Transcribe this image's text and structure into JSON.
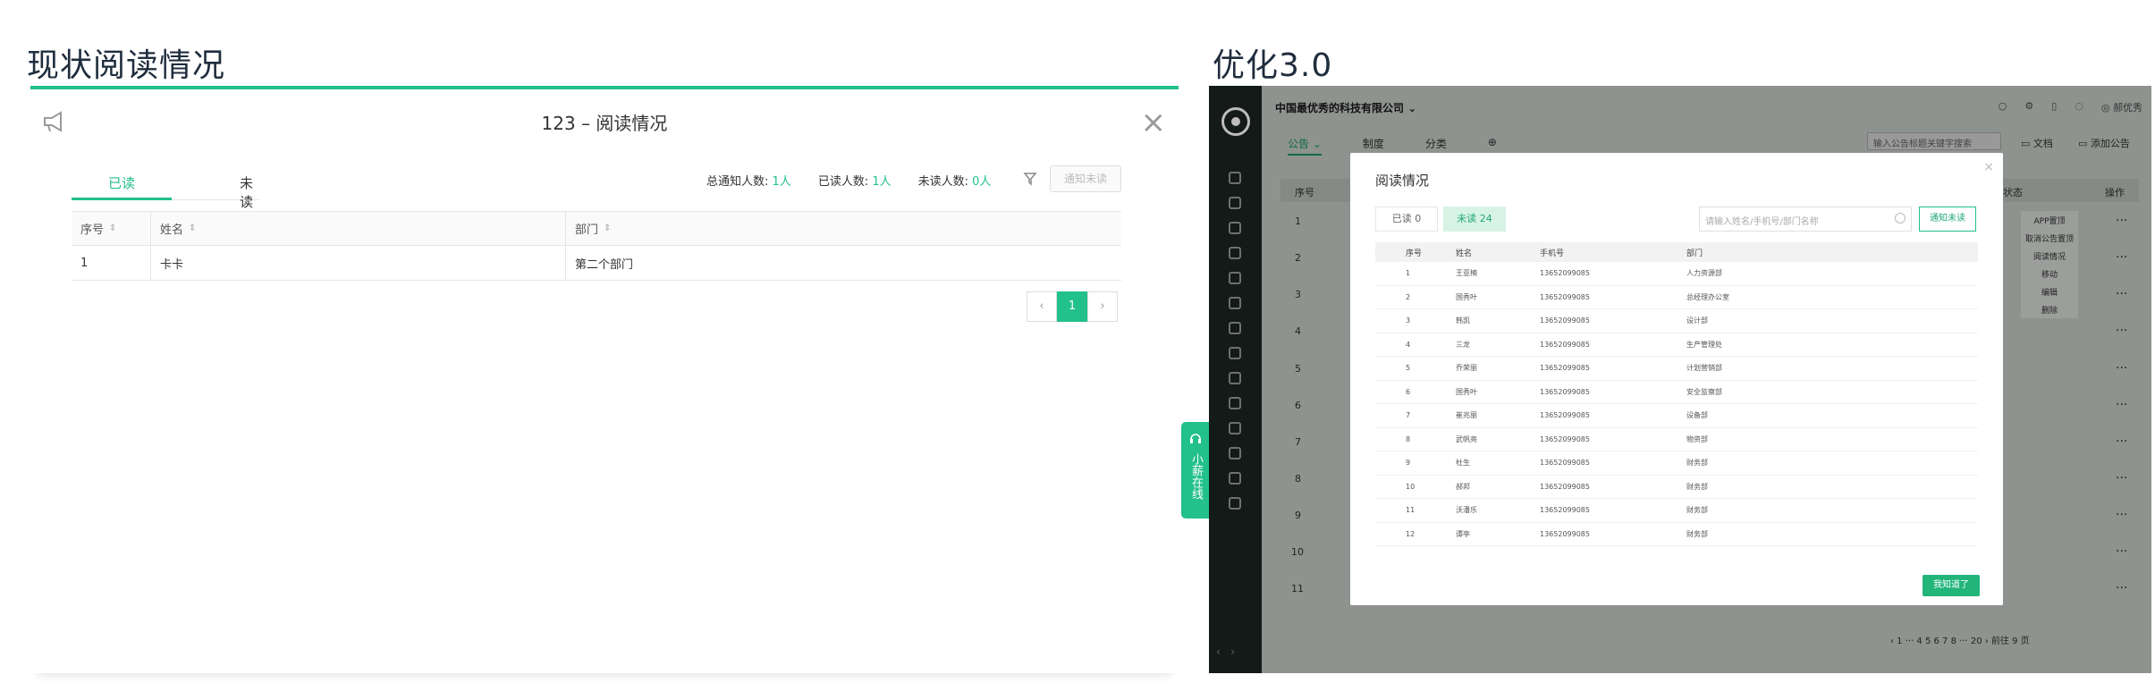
{
  "left_heading": "现状阅读情况",
  "right_heading": "优化3.0",
  "left_panel": {
    "title": "123 – 阅读情况",
    "tabs": [
      "已读",
      "未读"
    ],
    "stats": [
      {
        "label": "总通知人数:",
        "value": "1人"
      },
      {
        "label": "已读人数:",
        "value": "1人"
      },
      {
        "label": "未读人数:",
        "value": "0人"
      }
    ],
    "notify_button": "通知未读",
    "columns": [
      "序号",
      "姓名",
      "部门"
    ],
    "rows": [
      {
        "index": "1",
        "name": "卡卡",
        "dept": "第二个部门"
      }
    ],
    "pager": {
      "prev": "‹",
      "current": "1",
      "next": "›"
    },
    "chat_text": "小薪在线"
  },
  "right_panel": {
    "company": "中国最优秀的科技有限公司",
    "user": "郝优秀",
    "tabs": [
      "公告",
      "制度",
      "分类"
    ],
    "search_placeholder": "输入公告标题关键字搜索",
    "doc_button": "文档",
    "add_button": "添加公告",
    "table_head": {
      "index": "序号",
      "status": "状态",
      "action": "操作"
    },
    "bg_rows": [
      "1",
      "2",
      "3",
      "4",
      "5",
      "6",
      "7",
      "8",
      "9",
      "10",
      "11"
    ],
    "row_menu": [
      "APP置顶",
      "取消公告置顶",
      "阅读情况",
      "移动",
      "编辑",
      "删除"
    ],
    "pagination": "‹ 1 ··· 4 5 6 7 8 ··· 20 › 前往 9 页",
    "modal": {
      "title": "阅读情况",
      "close": "×",
      "tab_read": "已读 0",
      "tab_unread": "未读 24",
      "search_placeholder": "请输入姓名/手机号/部门名称",
      "notify_button": "通知未读",
      "columns": [
        "序号",
        "姓名",
        "手机号",
        "部门"
      ],
      "rows": [
        {
          "index": "1",
          "name": "王亚楠",
          "phone": "13652099085",
          "dept": "人力资源部"
        },
        {
          "index": "2",
          "name": "国秀叶",
          "phone": "13652099085",
          "dept": "总经理办公室"
        },
        {
          "index": "3",
          "name": "韩凯",
          "phone": "13652099085",
          "dept": "设计部"
        },
        {
          "index": "4",
          "name": "三龙",
          "phone": "13652099085",
          "dept": "生产管理处"
        },
        {
          "index": "5",
          "name": "乔荣丽",
          "phone": "13652099085",
          "dept": "计划营销部"
        },
        {
          "index": "6",
          "name": "国秀叶",
          "phone": "13652099085",
          "dept": "安全监察部"
        },
        {
          "index": "7",
          "name": "崔兆丽",
          "phone": "13652099085",
          "dept": "设备部"
        },
        {
          "index": "8",
          "name": "武帆亮",
          "phone": "13652099085",
          "dept": "物资部"
        },
        {
          "index": "9",
          "name": "杜生",
          "phone": "13652099085",
          "dept": "财务部"
        },
        {
          "index": "10",
          "name": "郝邦",
          "phone": "13652099085",
          "dept": "财务部"
        },
        {
          "index": "11",
          "name": "沃潘乐",
          "phone": "13652099085",
          "dept": "财务部"
        },
        {
          "index": "12",
          "name": "谭亭",
          "phone": "13652099085",
          "dept": "财务部"
        }
      ],
      "ok_button": "我知道了"
    }
  }
}
